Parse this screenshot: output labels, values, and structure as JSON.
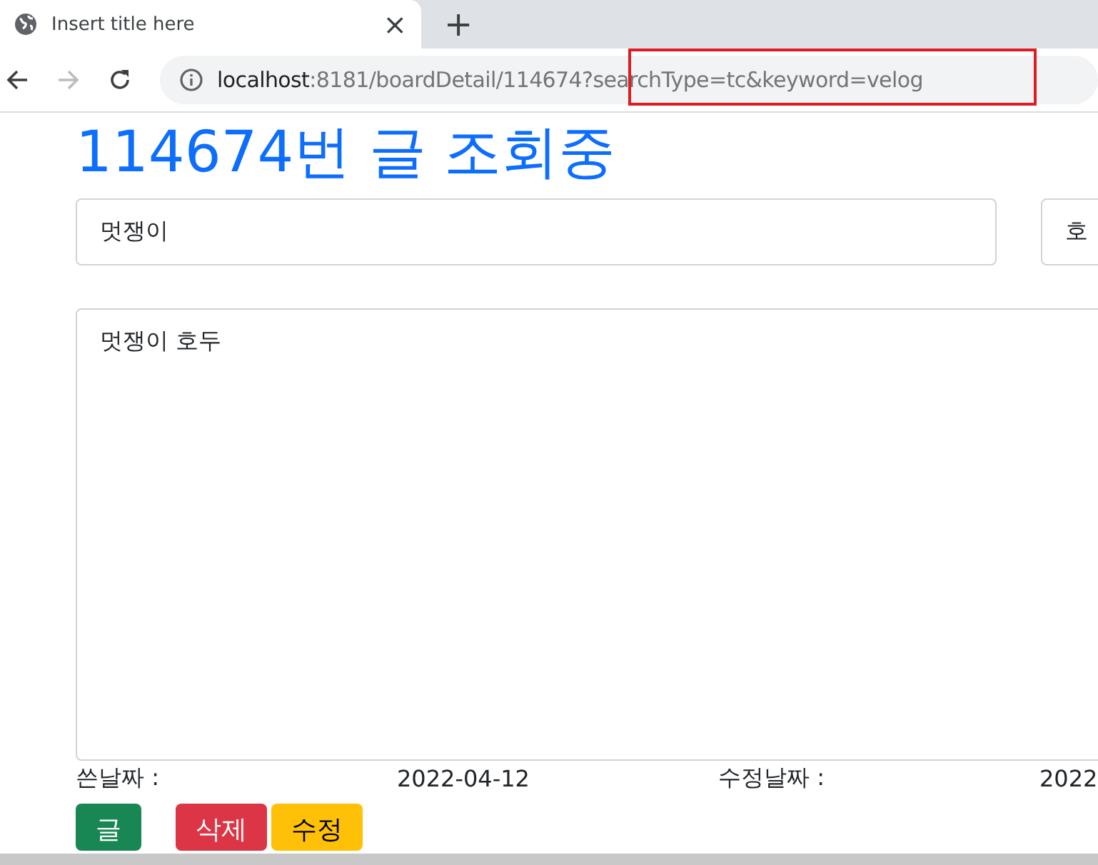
{
  "browser": {
    "tab": {
      "title": "Insert title here",
      "close": "×"
    },
    "new_tab": "+",
    "address": {
      "host": "localhost",
      "path": ":8181/boardDetail/114674?searchType=tc&keyword=velog"
    }
  },
  "page": {
    "heading": "114674번 글 조회중",
    "title_field": {
      "value": "멋쟁이"
    },
    "writer_field": {
      "value": "호"
    },
    "content_field": {
      "value": "멋쟁이 호두"
    },
    "dates": [
      {
        "label": "쓴날짜 :",
        "value": "2022-04-12"
      },
      {
        "label": "수정날짜 :",
        "value": "2022"
      }
    ],
    "buttons": [
      {
        "label": "글",
        "kind": "success"
      },
      {
        "label": "삭제",
        "kind": "danger"
      },
      {
        "label": "수정",
        "kind": "warning"
      }
    ]
  }
}
